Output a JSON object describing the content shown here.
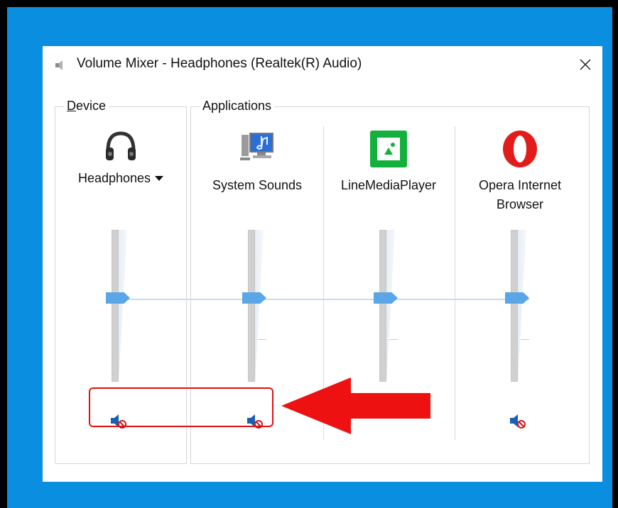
{
  "window": {
    "title": "Volume Mixer - Headphones (Realtek(R) Audio)",
    "title_icon": "speaker-icon",
    "close_glyph": "✕"
  },
  "groups": {
    "device_label_hotkey": "D",
    "device_label_rest": "evice",
    "applications_label": "Applications"
  },
  "channels": [
    {
      "id": "device",
      "label": "Headphones",
      "icon": "headphones-icon",
      "volume_fraction": 0.55,
      "muted": true,
      "mute_icon": "speaker-muted-icon"
    },
    {
      "id": "system-sounds",
      "label": "System Sounds",
      "icon": "system-sounds-icon",
      "volume_fraction": 0.55,
      "muted": true,
      "mute_icon": "speaker-muted-icon"
    },
    {
      "id": "line-media-player",
      "label": "LineMediaPlayer",
      "icon": "line-media-player-icon",
      "volume_fraction": 0.55,
      "muted": false
    },
    {
      "id": "opera",
      "label": "Opera Internet Browser",
      "icon": "opera-icon",
      "volume_fraction": 0.55,
      "muted": true,
      "mute_icon": "speaker-muted-icon"
    }
  ],
  "colors": {
    "desktop": "#0a8ee0",
    "thumb": "#5aa6e6",
    "highlight": "#e01010",
    "line_media_green": "#13b13b",
    "opera_red": "#e21b1b"
  }
}
